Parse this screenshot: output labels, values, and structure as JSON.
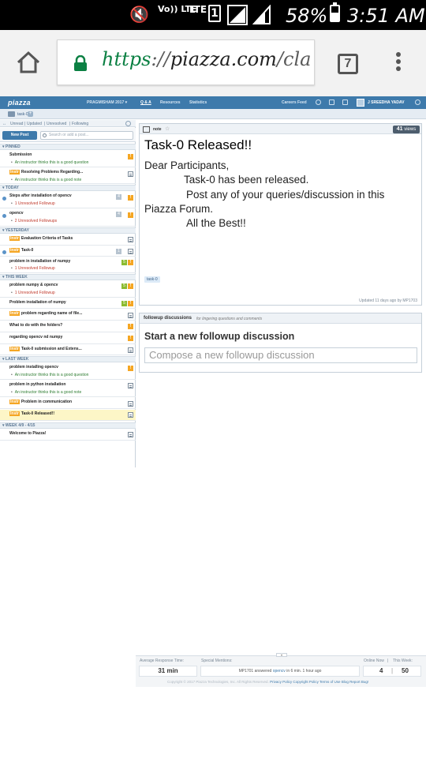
{
  "status_bar": {
    "volte": "Vo)) LTE",
    "lte": "LTE",
    "sim_slot": "1",
    "battery_text": "58%",
    "battery_level": 0.58,
    "time": "3:51 AM",
    "icons": [
      "mute-icon",
      "signal-icon",
      "battery-icon"
    ]
  },
  "browser": {
    "url_scheme": "https",
    "url_sep": "://",
    "url_host": "piazza.com",
    "url_rest": "/cla",
    "tab_count": "7",
    "icons": [
      "home-icon",
      "lock-icon",
      "tabs-icon",
      "menu-icon"
    ]
  },
  "piazza": {
    "logo": "piazza",
    "nav": {
      "class_menu": "PRAGMISHAM 2017 ▾",
      "qa": "Q & A",
      "resources": "Resources",
      "statistics": "Statistics",
      "careers": "Careers Feed",
      "user": "J SREEDHA YADAV"
    },
    "folder": {
      "name": "task-0",
      "add": "+"
    },
    "filters": [
      "Unread",
      "Updated",
      "Unresolved",
      "Following"
    ],
    "filter_sep": "|",
    "new_post": "New Post",
    "search_placeholder": "Search or add a post...",
    "groups": {
      "pinned": "▾ PINNED",
      "today": "▾ TODAY",
      "yesterday": "▾ YESTERDAY",
      "this_week": "▾ THIS WEEK",
      "last_week": "▾ LAST WEEK",
      "week": "▾ WEEK 4/9 - 4/15"
    },
    "instr_tag": "Instr",
    "posts": [
      {
        "title": "Submission",
        "sub": "An instructor thinks this is a good question"
      },
      {
        "title": "Resolving Problems Regarding...",
        "sub": "An instructor thinks this is a good note"
      },
      {
        "title": "Steps after installation of opencv",
        "sub": "1 Unresolved Followup",
        "count": "4"
      },
      {
        "title": "opencv",
        "sub": "2 Unresolved Followups",
        "count": "4"
      },
      {
        "title": "Evaluation Criteria of Tasks"
      },
      {
        "title": "Task-0",
        "count": "1"
      },
      {
        "title": "problem in installation of numpy",
        "sub": "1 Unresolved Followup",
        "green": "5"
      },
      {
        "title": "problem numpy & opencv",
        "sub": "1 Unresolved Followup",
        "green": "5"
      },
      {
        "title": "Problem installation of numpy",
        "green": "5"
      },
      {
        "title": "problem regarding name of file..."
      },
      {
        "title": "What to do with the folders?"
      },
      {
        "title": "regarding opencv nd numpy"
      },
      {
        "title": "Task-0 submission and Extens..."
      },
      {
        "title": "problem installing opencv",
        "sub": "An instructor thinks this is a good question"
      },
      {
        "title": "problem in python installation",
        "sub": "An instructor thinks this is a good note"
      },
      {
        "title": "Problem in communication"
      },
      {
        "title": "Task-0 Released!!"
      },
      {
        "title": "Welcome to Piazza!"
      }
    ],
    "note": {
      "type_label": "note",
      "views_count": "41",
      "views_label": "views",
      "title": "Task-0 Released!!",
      "body": [
        "Dear Participants,",
        "Task-0 has been released.",
        "Post any of your queries/discussion in this",
        "Piazza Forum.",
        "All the Best!!"
      ],
      "tag": "task-0",
      "updated": "Updated 11 days ago by MP1703"
    },
    "followup": {
      "header": "followup discussions",
      "header_sub": "for lingering questions and comments",
      "title": "Start a new followup discussion",
      "placeholder": "Compose a new followup discussion"
    },
    "stats": {
      "avg_label": "Average Response Time:",
      "avg_value": "31 min",
      "special_label": "Special Mentions:",
      "special_text_pre": "MP1701 answered",
      "special_link": "opencv",
      "special_text_post": "in 6 min. 1 hour ago",
      "online_label": "Online Now",
      "week_label": "This Week:",
      "stat_sep": "|",
      "online_value": "4",
      "week_value": "50",
      "copyright": "Copyright © 2017 Piazza Technologies, Inc. All Rights Reserved.",
      "links": [
        "Privacy Policy",
        "Copyright Policy",
        "Terms of Use",
        "Blog",
        "Report Bug!"
      ]
    }
  }
}
